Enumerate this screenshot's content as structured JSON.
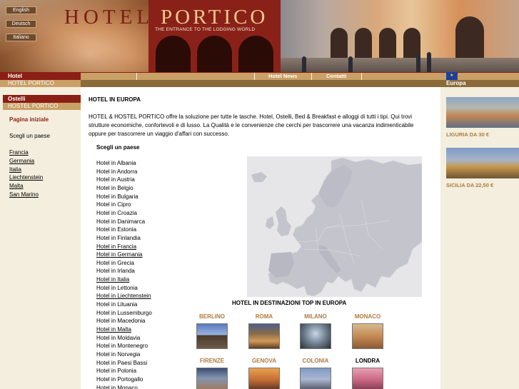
{
  "header": {
    "languages": [
      "English",
      "Deutsch",
      "Italiano"
    ],
    "brand_left": "HOTEL",
    "brand_right": "PORTICO",
    "tagline": "THE ENTRANCE TO THE LODGING WORLD"
  },
  "nav": {
    "hotel_label": "Hotel",
    "hotel_sub": "HOTEL PORTICO",
    "hotel_news": "Hotel News",
    "contatti": "Contatti",
    "europa": "Europa",
    "flag_icon": "eu-flag-icon"
  },
  "sidebar": {
    "ostelli_label": "Ostelli",
    "ostelli_sub": "HOSTEL PORTICO",
    "home": "Pagina iniziale",
    "choose": "Scegli un paese",
    "countries": [
      "Francia",
      "Germania",
      "Italia",
      "Liechtenstein",
      "Malta",
      "San Marino"
    ]
  },
  "main": {
    "title": "HOTEL IN EUROPA",
    "intro": "HOTEL & HOSTEL PORTICO offre la soluzione per tutte le tasche. Hotel, Ostelli, Bed & Breakfast e alloggi di tutti i tipi. Qui trovi strutture economiche, confortevoli e di lusso. La Qualità e le convenienze che cerchi per trascorrere una vacanza indimenticabile oppure per trascorrere un viaggio d'affari con successo.",
    "select_label": "Scegli un paese",
    "hotels": [
      {
        "label": "Hotel in Albania",
        "link": false
      },
      {
        "label": "Hotel in Andorra",
        "link": false
      },
      {
        "label": "Hotel in Austria",
        "link": false
      },
      {
        "label": "Hotel in Belgio",
        "link": false
      },
      {
        "label": "Hotel in Bulgaria",
        "link": false
      },
      {
        "label": "Hotel in Cipro",
        "link": false
      },
      {
        "label": "Hotel in Croazia",
        "link": false
      },
      {
        "label": "Hotel in Danimarca",
        "link": false
      },
      {
        "label": "Hotel in Estonia",
        "link": false
      },
      {
        "label": "Hotel in Finlandia",
        "link": false
      },
      {
        "label": "Hotel in Francia",
        "link": true
      },
      {
        "label": "Hotel in Germania",
        "link": true
      },
      {
        "label": "Hotel in Grecia",
        "link": false
      },
      {
        "label": "Hotel in Irlanda",
        "link": false
      },
      {
        "label": "Hotel in Italia",
        "link": true
      },
      {
        "label": "Hotel in Lettonia",
        "link": false
      },
      {
        "label": "Hotel in Liechtenstein",
        "link": true
      },
      {
        "label": "Hotel in Lituania",
        "link": false
      },
      {
        "label": "Hotel in Lussemburgo",
        "link": false
      },
      {
        "label": "Hotel in Macedonia",
        "link": false
      },
      {
        "label": "Hotel in Malta",
        "link": true
      },
      {
        "label": "Hotel in Moldavia",
        "link": false
      },
      {
        "label": "Hotel in Montenegro",
        "link": false
      },
      {
        "label": "Hotel in Norvegia",
        "link": false
      },
      {
        "label": "Hotel in Paesi Bassi",
        "link": false
      },
      {
        "label": "Hotel in Polonia",
        "link": false
      },
      {
        "label": "Hotel in Portogallo",
        "link": false
      },
      {
        "label": "Hotel in Monaco",
        "link": false
      }
    ],
    "top_dest_title": "HOTEL IN DESTINAZIONI TOP IN EUROPA",
    "cities_row1": [
      "BERLINO",
      "ROMA",
      "MILANO",
      "MONACO"
    ],
    "cities_row2": [
      "FIRENZE",
      "GENOVA",
      "COLONIA",
      "LONDRA"
    ]
  },
  "right": {
    "promos": [
      {
        "label": "LIGURIA DA 30 €"
      },
      {
        "label": "SICILIA DA 22,50 €"
      }
    ]
  }
}
